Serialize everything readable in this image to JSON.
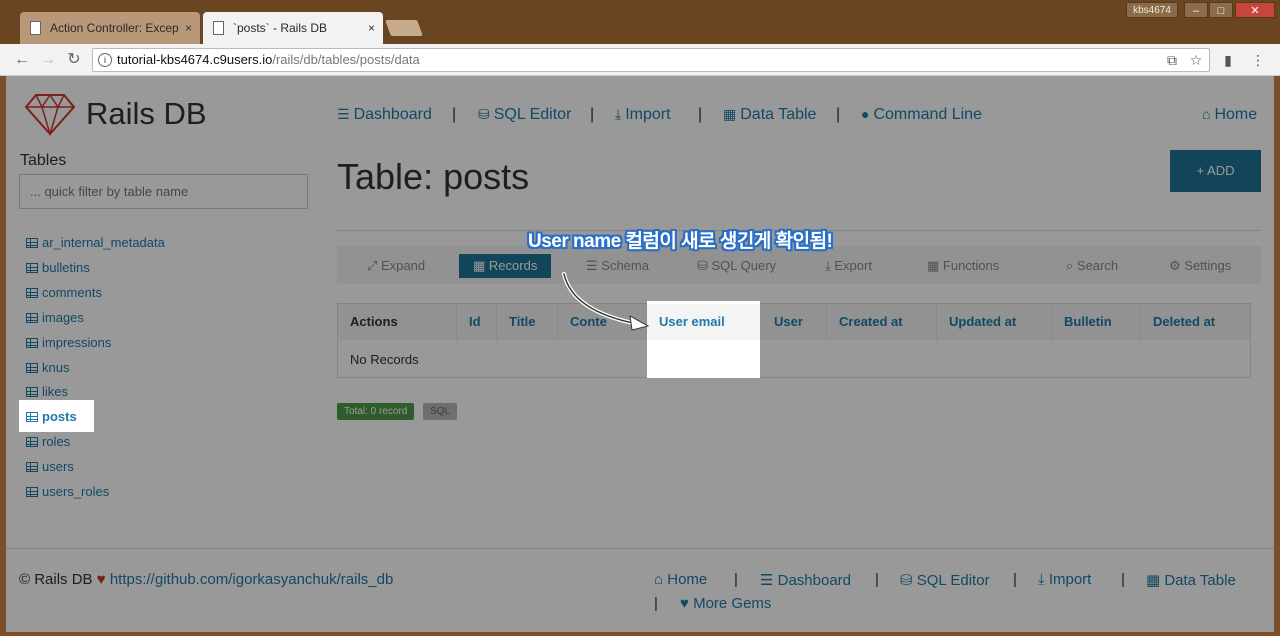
{
  "browser": {
    "tabs": [
      {
        "title": "Action Controller: Excep",
        "close": "×"
      },
      {
        "title": "`posts` - Rails DB",
        "close": "×"
      }
    ],
    "window_user": "kbs4674",
    "window_controls": {
      "minimize": "–",
      "maximize": "□",
      "close": "✕"
    },
    "url_host": "tutorial-kbs4674.c9users.io",
    "url_path": "/rails/db/tables/posts/data"
  },
  "app": {
    "logo_text": "Rails DB",
    "nav": [
      {
        "label": "Dashboard",
        "icon": "list-icon"
      },
      {
        "label": "SQL Editor",
        "icon": "database-icon"
      },
      {
        "label": "Import",
        "icon": "download-icon"
      },
      {
        "label": "Data Table",
        "icon": "table-icon"
      },
      {
        "label": "Command Line",
        "icon": "circle-icon"
      }
    ],
    "nav_separator": "|",
    "home_label": "Home"
  },
  "sidebar": {
    "heading": "Tables",
    "filter_placeholder": "... quick filter by table name",
    "tables": [
      "ar_internal_metadata",
      "bulletins",
      "comments",
      "images",
      "impressions",
      "knus",
      "likes",
      "posts",
      "roles",
      "users",
      "users_roles"
    ],
    "active_table": "posts"
  },
  "main": {
    "title": "Table: posts",
    "add_label": "+ ADD",
    "subnav": [
      {
        "label": "Expand",
        "icon": "expand-icon"
      },
      {
        "label": "Records",
        "icon": "table-icon"
      },
      {
        "label": "Schema",
        "icon": "list-icon"
      },
      {
        "label": "SQL Query",
        "icon": "database-icon"
      },
      {
        "label": "Export",
        "icon": "download-icon"
      },
      {
        "label": "Functions",
        "icon": "grid-icon"
      },
      {
        "label": "Search",
        "icon": "search-icon"
      },
      {
        "label": "Settings",
        "icon": "cogs-icon"
      }
    ],
    "active_subnav": "Records",
    "columns": [
      "Actions",
      "Id",
      "Title",
      "Conte",
      "User email",
      "User",
      "Created at",
      "Updated at",
      "Bulletin",
      "Deleted at"
    ],
    "empty_text": "No Records",
    "badges": {
      "total": "Total: 0 record",
      "sql": "SQL"
    }
  },
  "annotation": "User name 컬럼이 새로 생긴게 확인됨!",
  "footer": {
    "copy_prefix": "© Rails DB",
    "repo_link": "https://github.com/igorkasyanchuk/rails_db",
    "links": [
      "Home",
      "Dashboard",
      "SQL Editor",
      "Import",
      "Data Table",
      "More Gems"
    ]
  },
  "colors": {
    "link": "#1f7aa8",
    "accent": "#1e7396",
    "success": "#4d9a4b",
    "logo": "#d0342c"
  }
}
